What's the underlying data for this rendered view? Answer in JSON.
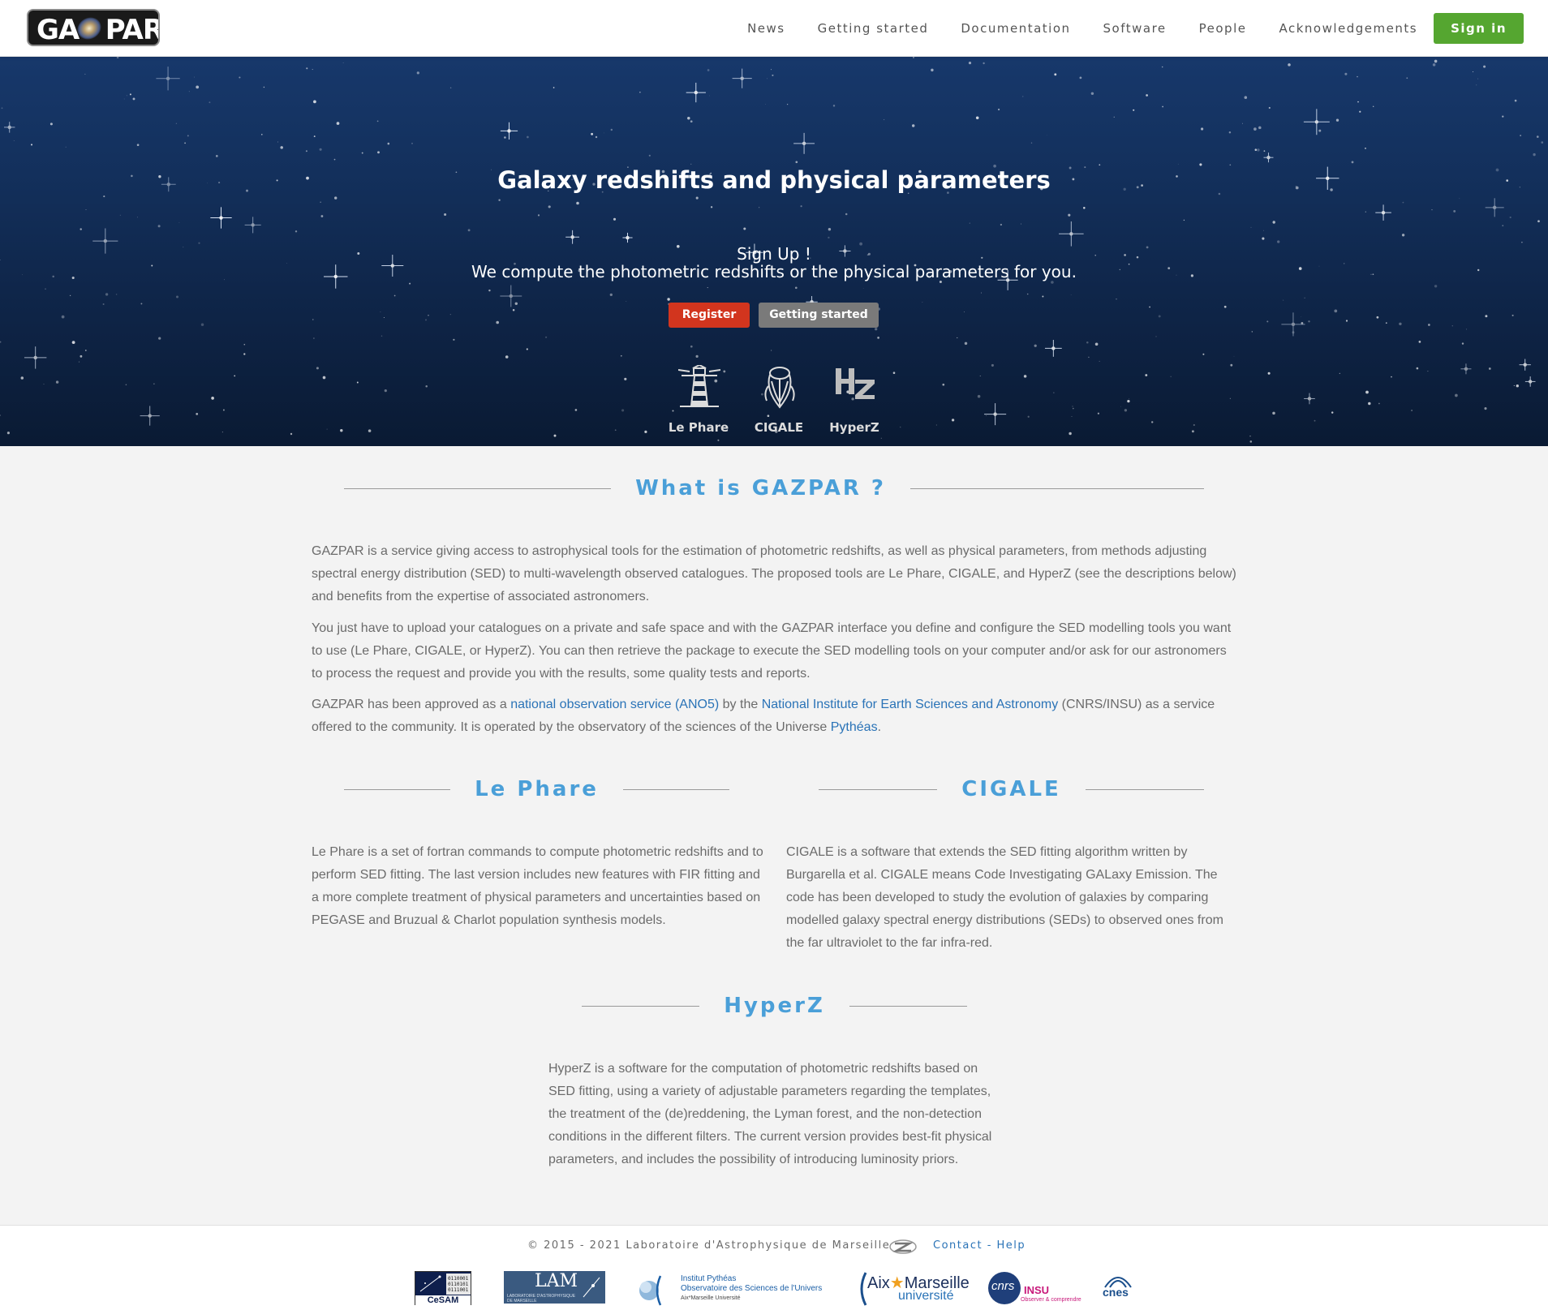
{
  "header": {
    "logo_alt": "GAZPAR",
    "nav": [
      "News",
      "Getting started",
      "Documentation",
      "Software",
      "People",
      "Acknowledgements"
    ],
    "signin_label": "Sign in"
  },
  "hero": {
    "title": "Galaxy redshifts and physical parameters",
    "subtitle_line1": "Sign Up !",
    "subtitle_line2": "We compute the photometric redshifts or the physical parameters for you.",
    "register_label": "Register",
    "getting_started_label": "Getting started",
    "tools": [
      {
        "label": "Le Phare",
        "icon": "lighthouse-icon"
      },
      {
        "label": "CIGALE",
        "icon": "cicada-icon"
      },
      {
        "label": "HyperZ",
        "icon": "hz-icon"
      }
    ]
  },
  "about": {
    "title": "What is GAZPAR ?",
    "p1": "GAZPAR is a service giving access to astrophysical tools for the estimation of photometric redshifts, as well as physical parameters, from methods adjusting spectral energy distribution (SED) to multi-wavelength observed catalogues. The proposed tools are Le Phare, CIGALE, and HyperZ (see the descriptions below) and benefits from the expertise of associated astronomers.",
    "p2": "You just have to upload your catalogues on a private and safe space and with the GAZPAR interface you define and configure the SED modelling tools you want to use (Le Phare, CIGALE, or HyperZ). You can then retrieve the package to execute the SED modelling tools on your computer and/or ask for our astronomers to process the request and provide you with the results, some quality tests and reports.",
    "p3_a": "GAZPAR has been approved as a ",
    "p3_link1": "national observation service (ANO5)",
    "p3_b": " by the ",
    "p3_link2": "National Institute for Earth Sciences and Astronomy",
    "p3_c": " (CNRS/INSU) as a service offered to the community. It is operated by the observatory of the sciences of the Universe ",
    "p3_link3": "Pythéas",
    "p3_d": "."
  },
  "lephare": {
    "title": "Le Phare",
    "text": "Le Phare is a set of fortran commands to compute photometric redshifts and to perform SED fitting. The last version includes new features with FIR fitting and a more complete treatment of physical parameters and uncertainties based on PEGASE and Bruzual & Charlot population synthesis models."
  },
  "cigale": {
    "title": "CIGALE",
    "text": "CIGALE is a software that extends the SED fitting algorithm written by Burgarella et al. CIGALE means Code Investigating GALaxy Emission. The code has been developed to study the evolution of galaxies by comparing modelled galaxy spectral energy distributions (SEDs) to observed ones from the far ultraviolet to the far infra-red."
  },
  "hyperz": {
    "title": "HyperZ",
    "text": "HyperZ is a software for the computation of photometric redshifts based on SED fitting, using a variety of adjustable parameters regarding the templates, the treatment of the (de)reddening, the Lyman forest, and the non-detection conditions in the different filters. The current version provides best-fit physical parameters, and includes the possibility of introducing luminosity priors."
  },
  "footer": {
    "copyright": "© 2015 - 2021 Laboratoire d'Astrophysique de Marseille",
    "contact": "Contact - Help",
    "partners": {
      "cesam": "CeSAM",
      "lam": "LAM",
      "lam_sub": "LABORATOIRE D'ASTROPHYSIQUE DE MARSEILLE",
      "pytheas_1": "Institut Pythéas",
      "pytheas_2": "Observatoire des Sciences de l'Univers",
      "pytheas_3": "Aix*Marseille Université",
      "amu_1": "Aix",
      "amu_2": "Marseille",
      "amu_3": "université",
      "cnrs": "cnrs",
      "insu": "INSU",
      "insu_sub": "Observer & comprendre",
      "cnes": "cnes"
    }
  },
  "colors": {
    "accent_blue": "#4a9fd8",
    "link_blue": "#2a73b7",
    "signin_green": "#55a630",
    "register_red": "#d2351e",
    "started_gray": "#7a7a7a"
  }
}
